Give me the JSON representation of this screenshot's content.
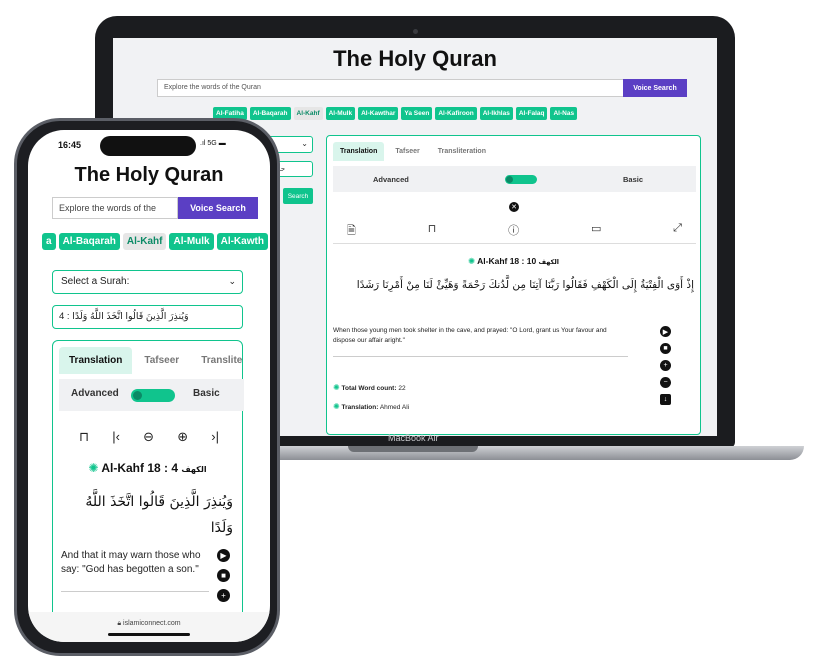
{
  "laptop": {
    "brand_label": "MacBook Air",
    "app": {
      "title": "The Holy Quran",
      "search_placeholder": "Explore the words of the Quran",
      "voice_button": "Voice Search",
      "surahs": [
        "Al-Fatiha",
        "Al-Baqarah",
        "Al-Kahf",
        "Al-Mulk",
        "Al-Kawthar",
        "Ya Seen",
        "Al-Kafiroon",
        "Al-Ikhlas",
        "Al-Falaq",
        "Al-Nas"
      ],
      "active_surah": "Al-Kahf",
      "left_verse_fragment": "حدُ لِلَّهِ الَّ",
      "left_search_button": "Search",
      "tabs": [
        "Translation",
        "Tafseer",
        "Transliteration"
      ],
      "active_tab": "Translation",
      "mode_advanced": "Advanced",
      "mode_basic": "Basic",
      "verse_ref": "Al-Kahf 18 : 10",
      "verse_ref_arabic": "الكهف",
      "arabic_text": "إِذْ أَوَى الْفِتْيَةُ إِلَى الْكَهْفِ فَقَالُوا رَبَّنَا آتِنَا مِن لَّدُنكَ رَحْمَةً وَهَيِّئْ لَنَا مِنْ أَمْرِنَا رَشَدًا",
      "translation": "When those young men took shelter in the cave, and prayed: \"O Lord, grant us Your favour and dispose our affair aright.\"",
      "word_count_label": "Total Word count:",
      "word_count_value": "22",
      "translation_label": "Translation:",
      "translator": "Ahmed Ali"
    }
  },
  "phone": {
    "time": "16:45",
    "signal": "5G",
    "app": {
      "title": "The Holy Quran",
      "search_placeholder": "Explore the words of the",
      "voice_button": "Voice Search",
      "surahs": [
        "a",
        "Al-Baqarah",
        "Al-Kahf",
        "Al-Mulk",
        "Al-Kawth"
      ],
      "active_surah": "Al-Kahf",
      "select_label": "Select a Surah:",
      "verse_field": "وَيُنذِرَ الَّذِينَ قَالُوا اتَّخَذَ اللَّهُ وَلَدًا : 4",
      "tabs": [
        "Translation",
        "Tafseer",
        "Translite"
      ],
      "active_tab": "Translation",
      "mode_advanced": "Advanced",
      "mode_basic": "Basic",
      "verse_ref": "Al-Kahf 18 : 4",
      "verse_ref_arabic": "الكهف",
      "arabic_text": "وَيُنذِرَ الَّذِينَ قَالُوا اتَّخَذَ اللَّهُ وَلَدًا",
      "translation": "And that it may warn those who say: \"God has begotten a son.\"",
      "url": "islamiconnect.com"
    }
  },
  "colors": {
    "accent": "#10c48d",
    "voice_button": "#5b3fc4"
  }
}
